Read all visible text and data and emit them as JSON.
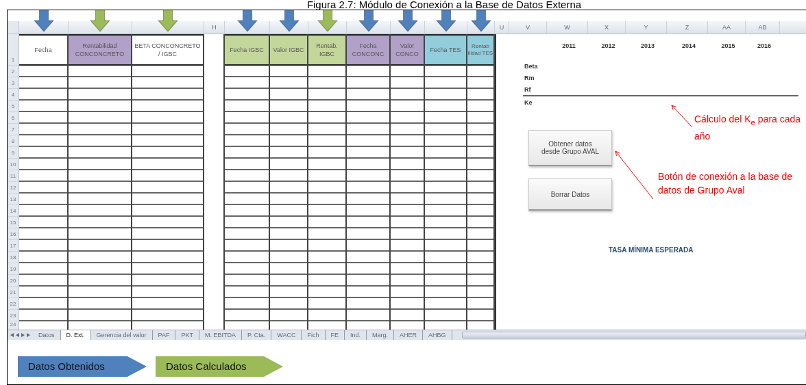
{
  "caption": "Figura 2.7: Módulo de Conexión a la Base de Datos Externa",
  "sheet": {
    "columns": [
      {
        "kind": "data",
        "header": "Fecha",
        "color": "#ffffff",
        "arrow": {
          "color": "#4f81bd"
        }
      },
      {
        "kind": "data",
        "header": "Rentabilidad CONCONCRETO",
        "color": "#b1a0c7",
        "arrow": {
          "color": "#9bbb59"
        }
      },
      {
        "kind": "data",
        "header": "BETA CONCONCRETO / IGBC",
        "color": "#ffffff",
        "arrow": {
          "color": "#9bbb59"
        }
      },
      {
        "kind": "spacer",
        "letter": "H"
      },
      {
        "kind": "data",
        "header": "Fecha IGBC",
        "color": "#c4d79b",
        "arrow": {
          "color": "#4f81bd"
        }
      },
      {
        "kind": "data",
        "header": "Valor IGBC",
        "color": "#c4d79b",
        "arrow": {
          "color": "#4f81bd"
        }
      },
      {
        "kind": "data",
        "header": "Rentab. IGBC",
        "color": "#c4d79b",
        "arrow": {
          "color": "#9bbb59"
        }
      },
      {
        "kind": "data",
        "header": "Fecha CONCONC",
        "color": "#b1a0c7",
        "arrow": {
          "color": "#4f81bd"
        }
      },
      {
        "kind": "data",
        "header": "Valor CONCO",
        "color": "#b1a0c7",
        "arrow": {
          "color": "#4f81bd"
        }
      },
      {
        "kind": "data",
        "header": "Fecha TES",
        "color": "#92cddc",
        "arrow": {
          "color": "#4f81bd"
        }
      },
      {
        "kind": "data",
        "header": "Rentab ilidad TES",
        "color": "#92cddc",
        "arrow": {
          "color": "#4f81bd"
        }
      },
      {
        "kind": "plain",
        "letter": "U"
      },
      {
        "kind": "plain",
        "letter": "V"
      },
      {
        "kind": "plain",
        "letter": "W"
      },
      {
        "kind": "plain",
        "letter": "X"
      },
      {
        "kind": "plain",
        "letter": "Y"
      },
      {
        "kind": "plain",
        "letter": "Z"
      },
      {
        "kind": "plain",
        "letter": "AA"
      },
      {
        "kind": "plain",
        "letter": "AB"
      }
    ],
    "row_numbers": [
      "1",
      "2",
      "3",
      "4",
      "5",
      "6",
      "7",
      "8",
      "9",
      "10",
      "11",
      "12",
      "13",
      "14",
      "15",
      "16",
      "17",
      "18",
      "19",
      "20",
      "21",
      "22",
      "23",
      "24"
    ],
    "years": [
      "2011",
      "2012",
      "2013",
      "2014",
      "2015",
      "2016"
    ],
    "factors": [
      {
        "label": "Beta",
        "kind": "input"
      },
      {
        "label": "Rm",
        "kind": "input"
      },
      {
        "label": "Rf",
        "kind": "input"
      },
      {
        "label": "Ke",
        "kind": "result"
      }
    ],
    "buttons": [
      "Obtener datos desde Grupo AVAL",
      "Borrar Datos"
    ],
    "title": "TASA MÍNIMA ESPERADA",
    "annotations": [
      "Cálculo del K$_{e}$ para cada año",
      "Botón de conexión a la base de datos de Grupo Aval"
    ],
    "tabs": [
      {
        "label": "Datos",
        "selected": false
      },
      {
        "label": "D. Ext.",
        "selected": true
      },
      {
        "label": "Gerencia del valor",
        "selected": false
      },
      {
        "label": "PAF",
        "selected": false
      },
      {
        "label": "PKT",
        "selected": false
      },
      {
        "label": "M. EBITDA",
        "selected": false
      },
      {
        "label": "P. Cta.",
        "selected": false
      },
      {
        "label": "WACC",
        "selected": false
      },
      {
        "label": "Fich",
        "selected": false
      },
      {
        "label": "FE",
        "selected": false
      },
      {
        "label": "Ind.",
        "selected": false
      },
      {
        "label": "Marg.",
        "selected": false
      },
      {
        "label": "AHER",
        "selected": false
      },
      {
        "label": "AHBG",
        "selected": false
      }
    ]
  },
  "legend": [
    {
      "label": "Datos Obtenidos",
      "color": "#4f81bd"
    },
    {
      "label": "Datos Calculados",
      "color": "#9bbb59"
    }
  ]
}
